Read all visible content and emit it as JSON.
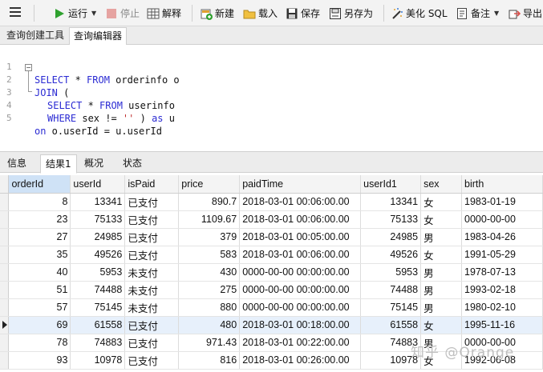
{
  "toolbar": {
    "run": "运行",
    "stop": "停止",
    "explain": "解释",
    "new": "新建",
    "load": "载入",
    "save": "保存",
    "save_as": "另存为",
    "beautify": "美化 SQL",
    "note": "备注",
    "export": "导出"
  },
  "editor_tabs": [
    "查询创建工具",
    "查询编辑器"
  ],
  "sql": {
    "line_numbers": [
      "1",
      "2",
      "3",
      "4",
      "5"
    ]
  },
  "result_tabs": [
    "信息",
    "结果1",
    "概况",
    "状态"
  ],
  "grid": {
    "columns": [
      "orderId",
      "userId",
      "isPaid",
      "price",
      "paidTime",
      "userId1",
      "sex",
      "birth"
    ],
    "rows": [
      [
        "8",
        "13341",
        "已支付",
        "890.7",
        "2018-03-01 00:06:00.00",
        "13341",
        "女",
        "1983-01-19"
      ],
      [
        "23",
        "75133",
        "已支付",
        "1109.67",
        "2018-03-01 00:06:00.00",
        "75133",
        "女",
        "0000-00-00"
      ],
      [
        "27",
        "24985",
        "已支付",
        "379",
        "2018-03-01 00:05:00.00",
        "24985",
        "男",
        "1983-04-26"
      ],
      [
        "35",
        "49526",
        "已支付",
        "583",
        "2018-03-01 00:06:00.00",
        "49526",
        "女",
        "1991-05-29"
      ],
      [
        "40",
        "5953",
        "未支付",
        "430",
        "0000-00-00 00:00:00.00",
        "5953",
        "男",
        "1978-07-13"
      ],
      [
        "51",
        "74488",
        "未支付",
        "275",
        "0000-00-00 00:00:00.00",
        "74488",
        "男",
        "1993-02-18"
      ],
      [
        "57",
        "75145",
        "未支付",
        "880",
        "0000-00-00 00:00:00.00",
        "75145",
        "男",
        "1980-02-10"
      ],
      [
        "69",
        "61558",
        "已支付",
        "480",
        "2018-03-01 00:18:00.00",
        "61558",
        "女",
        "1995-11-16"
      ],
      [
        "78",
        "74883",
        "已支付",
        "971.43",
        "2018-03-01 00:22:00.00",
        "74883",
        "男",
        "0000-00-00"
      ],
      [
        "93",
        "10978",
        "已支付",
        "816",
        "2018-03-01 00:26:00.00",
        "10978",
        "女",
        "1992-06-08"
      ]
    ],
    "selected_row_index": 7
  },
  "watermark": "知乎 @Orange",
  "colors": {
    "keyword": "#2b2bd3",
    "string": "#c03030",
    "run_icon": "#2fa12f",
    "stop_icon": "#d9534f"
  }
}
